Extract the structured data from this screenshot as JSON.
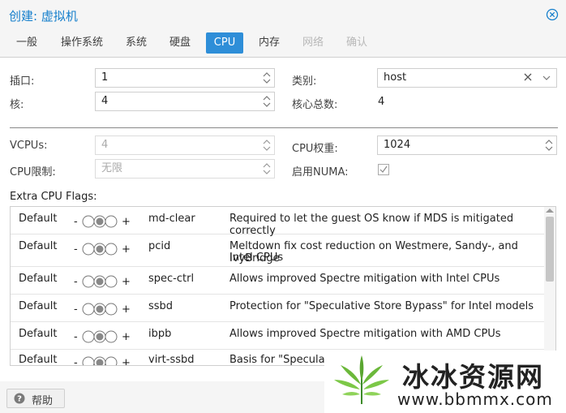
{
  "dialog": {
    "title": "创建: 虚拟机"
  },
  "tabs": [
    {
      "label": "一般",
      "state": "normal"
    },
    {
      "label": "操作系统",
      "state": "normal"
    },
    {
      "label": "系统",
      "state": "normal"
    },
    {
      "label": "硬盘",
      "state": "normal"
    },
    {
      "label": "CPU",
      "state": "active"
    },
    {
      "label": "内存",
      "state": "normal"
    },
    {
      "label": "网络",
      "state": "disabled"
    },
    {
      "label": "确认",
      "state": "disabled"
    }
  ],
  "form": {
    "sockets_label": "插口:",
    "sockets_value": "1",
    "cores_label": "核:",
    "cores_value": "4",
    "type_label": "类别:",
    "type_value": "host",
    "total_cores_label": "核心总数:",
    "total_cores_value": "4",
    "vcpus_label": "VCPUs:",
    "vcpus_value": "4",
    "cpulimit_label": "CPU限制:",
    "cpulimit_placeholder": "无限",
    "cpuunits_label": "CPU权重:",
    "cpuunits_value": "1024",
    "numa_label": "启用NUMA:",
    "numa_checked": false
  },
  "flags": {
    "label": "Extra CPU Flags:",
    "rows": [
      {
        "state": "Default",
        "minus": "-",
        "plus": "+",
        "name": "md-clear",
        "desc1": "Required to let the guest OS know if MDS is mitigated correctly",
        "desc2": ""
      },
      {
        "state": "Default",
        "minus": "-",
        "plus": "+",
        "name": "pcid",
        "desc1": "Meltdown fix cost reduction on Westmere, Sandy-, and IvyBridge",
        "desc2": "Intel CPUs"
      },
      {
        "state": "Default",
        "minus": "-",
        "plus": "+",
        "name": "spec-ctrl",
        "desc1": "Allows improved Spectre mitigation with Intel CPUs",
        "desc2": ""
      },
      {
        "state": "Default",
        "minus": "-",
        "plus": "+",
        "name": "ssbd",
        "desc1": "Protection for \"Speculative Store Bypass\" for Intel models",
        "desc2": ""
      },
      {
        "state": "Default",
        "minus": "-",
        "plus": "+",
        "name": "ibpb",
        "desc1": "Allows improved Spectre mitigation with AMD CPUs",
        "desc2": ""
      },
      {
        "state": "Default",
        "minus": "-",
        "plus": "+",
        "name": "virt-ssbd",
        "desc1": "Basis for \"Speculati",
        "desc2": ""
      }
    ]
  },
  "footer": {
    "help_label": "帮助"
  },
  "watermark": {
    "cn": "冰冰资源网",
    "url": "www.bbmmx.com"
  },
  "colors": {
    "accent": "#157fcc",
    "tab_active_bg": "#2e8ed8"
  }
}
